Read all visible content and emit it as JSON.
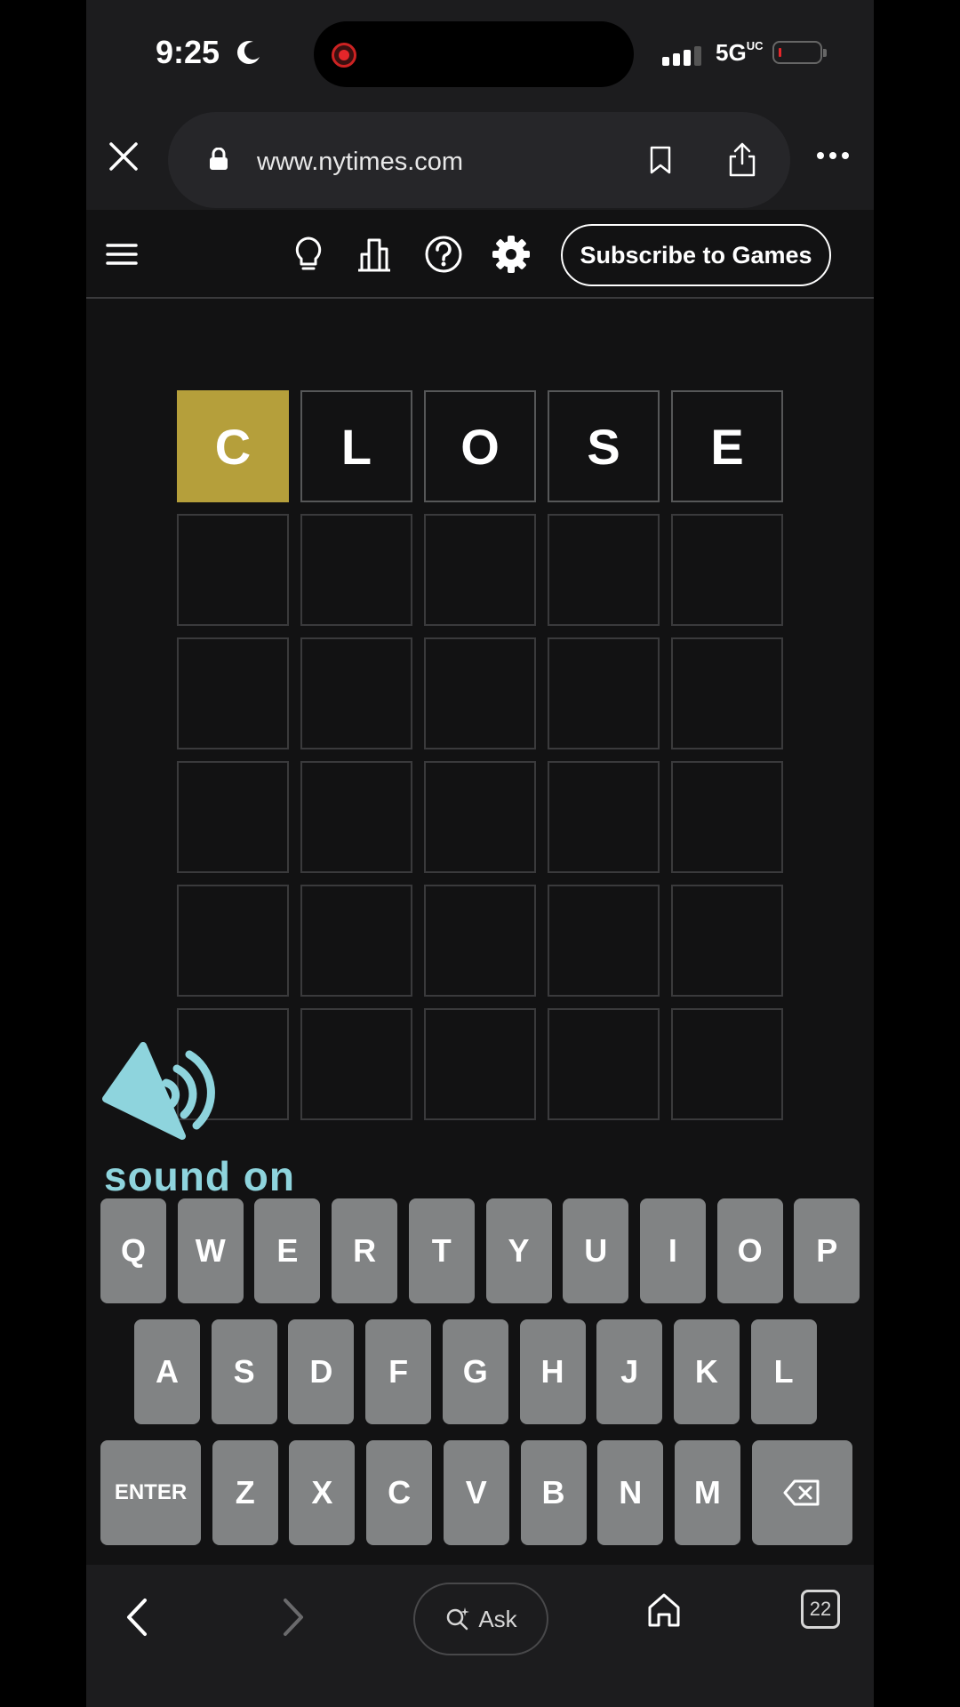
{
  "status_bar": {
    "time": "9:25",
    "network": "5G",
    "network_suffix": "UC"
  },
  "browser": {
    "url": "www.nytimes.com"
  },
  "header": {
    "icons": [
      "hint-icon",
      "stats-icon",
      "help-icon",
      "settings-icon"
    ],
    "subscribe_label": "Subscribe to Games"
  },
  "board": {
    "rows": [
      [
        {
          "letter": "C",
          "state": "present"
        },
        {
          "letter": "L",
          "state": "tbd"
        },
        {
          "letter": "O",
          "state": "tbd"
        },
        {
          "letter": "S",
          "state": "tbd"
        },
        {
          "letter": "E",
          "state": "tbd"
        }
      ],
      [
        {
          "letter": "",
          "state": "empty"
        },
        {
          "letter": "",
          "state": "empty"
        },
        {
          "letter": "",
          "state": "empty"
        },
        {
          "letter": "",
          "state": "empty"
        },
        {
          "letter": "",
          "state": "empty"
        }
      ],
      [
        {
          "letter": "",
          "state": "empty"
        },
        {
          "letter": "",
          "state": "empty"
        },
        {
          "letter": "",
          "state": "empty"
        },
        {
          "letter": "",
          "state": "empty"
        },
        {
          "letter": "",
          "state": "empty"
        }
      ],
      [
        {
          "letter": "",
          "state": "empty"
        },
        {
          "letter": "",
          "state": "empty"
        },
        {
          "letter": "",
          "state": "empty"
        },
        {
          "letter": "",
          "state": "empty"
        },
        {
          "letter": "",
          "state": "empty"
        }
      ],
      [
        {
          "letter": "",
          "state": "empty"
        },
        {
          "letter": "",
          "state": "empty"
        },
        {
          "letter": "",
          "state": "empty"
        },
        {
          "letter": "",
          "state": "empty"
        },
        {
          "letter": "",
          "state": "empty"
        }
      ],
      [
        {
          "letter": "",
          "state": "empty"
        },
        {
          "letter": "",
          "state": "empty"
        },
        {
          "letter": "",
          "state": "empty"
        },
        {
          "letter": "",
          "state": "empty"
        },
        {
          "letter": "",
          "state": "empty"
        }
      ]
    ],
    "colors": {
      "present": "#b59f3b",
      "tile_border": "#3a3a3c",
      "key": "#818384"
    }
  },
  "overlay": {
    "sound_label": "sound on",
    "color": "#8ed4dd"
  },
  "keyboard": {
    "rows": [
      [
        "Q",
        "W",
        "E",
        "R",
        "T",
        "Y",
        "U",
        "I",
        "O",
        "P"
      ],
      [
        "A",
        "S",
        "D",
        "F",
        "G",
        "H",
        "J",
        "K",
        "L"
      ],
      [
        "ENTER",
        "Z",
        "X",
        "C",
        "V",
        "B",
        "N",
        "M",
        "backspace-icon"
      ]
    ]
  },
  "bottom_bar": {
    "ask_label": "Ask",
    "tab_count": "22"
  }
}
